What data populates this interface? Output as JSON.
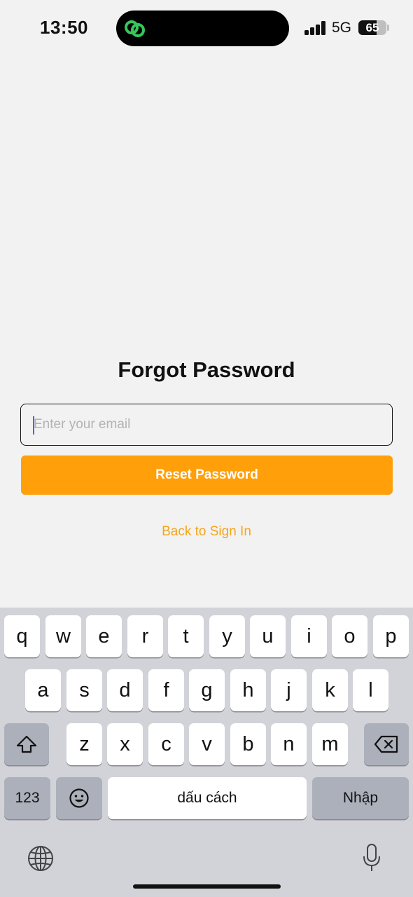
{
  "status_bar": {
    "time": "13:50",
    "network": "5G",
    "battery_level": "65",
    "battery_fraction": 0.65,
    "signal_bars": 4,
    "island_app_icon": "link-icon",
    "island_icon_color": "#34c759"
  },
  "form": {
    "title": "Forgot Password",
    "email_placeholder": "Enter your email",
    "email_value": "",
    "reset_label": "Reset Password",
    "back_link": "Back to Sign In",
    "accent_color": "#ff9f0a"
  },
  "keyboard": {
    "row1": [
      "q",
      "w",
      "e",
      "r",
      "t",
      "y",
      "u",
      "i",
      "o",
      "p"
    ],
    "row2": [
      "a",
      "s",
      "d",
      "f",
      "g",
      "h",
      "j",
      "k",
      "l"
    ],
    "row3": [
      "z",
      "x",
      "c",
      "v",
      "b",
      "n",
      "m"
    ],
    "numbers_label": "123",
    "space_label": "dấu cách",
    "return_label": "Nhập",
    "icons": [
      "shift-icon",
      "delete-icon",
      "emoji-icon",
      "globe-icon",
      "microphone-icon"
    ]
  }
}
